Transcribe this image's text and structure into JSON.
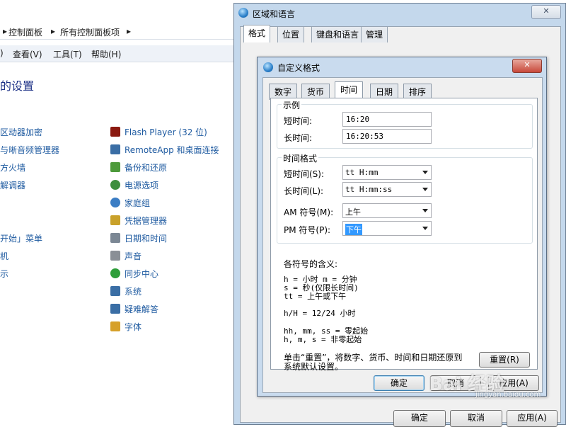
{
  "control_panel": {
    "breadcrumb": [
      "控制面板",
      "所有控制面板项"
    ],
    "menu": [
      "查看(V)",
      "工具(T)",
      "帮助(H)"
    ],
    "heading": "的设置",
    "left_items": [
      "区动器加密",
      "与晰音频管理器",
      "方火墙",
      "解调器",
      "开始」菜单",
      "机",
      "示"
    ],
    "right_items": [
      {
        "label": "Flash Player (32 位)",
        "icon": "flash-icon",
        "color": "#8b1a10"
      },
      {
        "label": "RemoteApp 和桌面连接",
        "icon": "remote-desktop-icon",
        "color": "#3a6ea5"
      },
      {
        "label": "备份和还原",
        "icon": "backup-icon",
        "color": "#4d9a3b"
      },
      {
        "label": "电源选项",
        "icon": "power-icon",
        "color": "#3e8e3e"
      },
      {
        "label": "家庭组",
        "icon": "homegroup-icon",
        "color": "#3b7dc4"
      },
      {
        "label": "凭据管理器",
        "icon": "credential-icon",
        "color": "#c9a12a"
      },
      {
        "label": "日期和时间",
        "icon": "clock-icon",
        "color": "#7b8794"
      },
      {
        "label": "声音",
        "icon": "speaker-icon",
        "color": "#8a8f96"
      },
      {
        "label": "同步中心",
        "icon": "sync-icon",
        "color": "#2e9e3a"
      },
      {
        "label": "系统",
        "icon": "system-icon",
        "color": "#3a6ea5"
      },
      {
        "label": "疑难解答",
        "icon": "troubleshoot-icon",
        "color": "#3a6ea5"
      },
      {
        "label": "字体",
        "icon": "font-icon",
        "color": "#d6a02a"
      }
    ]
  },
  "region_dialog": {
    "title": "区域和语言",
    "close": "✕",
    "tabs": [
      "格式",
      "位置",
      "键盘和语言",
      "管理"
    ],
    "selected_tab": "格式",
    "buttons": {
      "ok": "确定",
      "cancel": "取消",
      "apply": "应用(A)"
    }
  },
  "custom_dialog": {
    "title": "自定义格式",
    "close": "✕",
    "tabs": [
      "数字",
      "货币",
      "时间",
      "日期",
      "排序"
    ],
    "selected_tab": "时间",
    "example": {
      "group": "示例",
      "short_label": "短时间:",
      "short_value": "16:20",
      "long_label": "长时间:",
      "long_value": "16:20:53"
    },
    "formats": {
      "group": "时间格式",
      "short_label": "短时间(S):",
      "short_value": "tt H:mm",
      "long_label": "长时间(L):",
      "long_value": "tt H:mm:ss",
      "am_label": "AM 符号(M):",
      "am_value": "上午",
      "pm_label": "PM 符号(P):",
      "pm_value": "下午"
    },
    "meaning": {
      "title": "各符号的含义:",
      "lines1": [
        "h = 小时   m = 分钟",
        "s = 秒(仅限长时间)",
        "tt = 上午或下午"
      ],
      "line2": "h/H = 12/24 小时",
      "lines3": [
        "hh, mm, ss = 零起始",
        "h, m, s = 非零起始"
      ]
    },
    "reset_text": "单击“重置”，将数字、货币、时间和日期还原到系统默认设置。",
    "buttons": {
      "reset": "重置(R)",
      "ok": "确定",
      "cancel": "取消",
      "apply": "应用(A)"
    }
  },
  "watermark": {
    "main": "Bai 经验",
    "sub": "jingyan.baidu.com"
  }
}
